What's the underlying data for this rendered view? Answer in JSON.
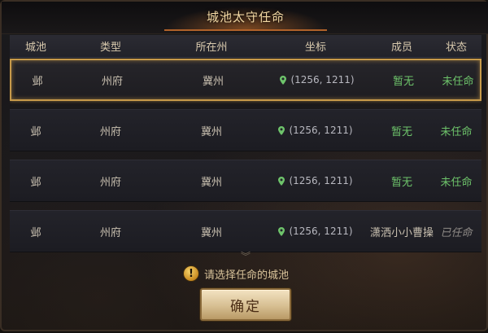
{
  "title": "城池太守任命",
  "columns": [
    "城池",
    "类型",
    "所在州",
    "坐标",
    "成员",
    "状态"
  ],
  "rows": [
    {
      "city": "邺",
      "type": "州府",
      "state": "冀州",
      "coord": "(1256, 1211)",
      "member": "暂无",
      "status": "未任命",
      "selected": true
    },
    {
      "city": "邺",
      "type": "州府",
      "state": "冀州",
      "coord": "(1256, 1211)",
      "member": "暂无",
      "status": "未任命",
      "selected": false
    },
    {
      "city": "邺",
      "type": "州府",
      "state": "冀州",
      "coord": "(1256, 1211)",
      "member": "暂无",
      "status": "未任命",
      "selected": false
    },
    {
      "city": "邺",
      "type": "州府",
      "state": "冀州",
      "coord": "(1256, 1211)",
      "member": "潇洒小小曹操",
      "status": "已任命",
      "selected": false
    }
  ],
  "notice": "请选择任命的城池",
  "confirm_label": "确定",
  "colors": {
    "accent_gold": "#c79a4a",
    "green_status": "#6ec46b",
    "title_text": "#f3d9a4",
    "pin_green": "#6ec46b"
  },
  "icons": {
    "location": "map-pin-icon",
    "notice": "exclamation-circle-icon",
    "scroll": "double-chevron-down-icon"
  }
}
